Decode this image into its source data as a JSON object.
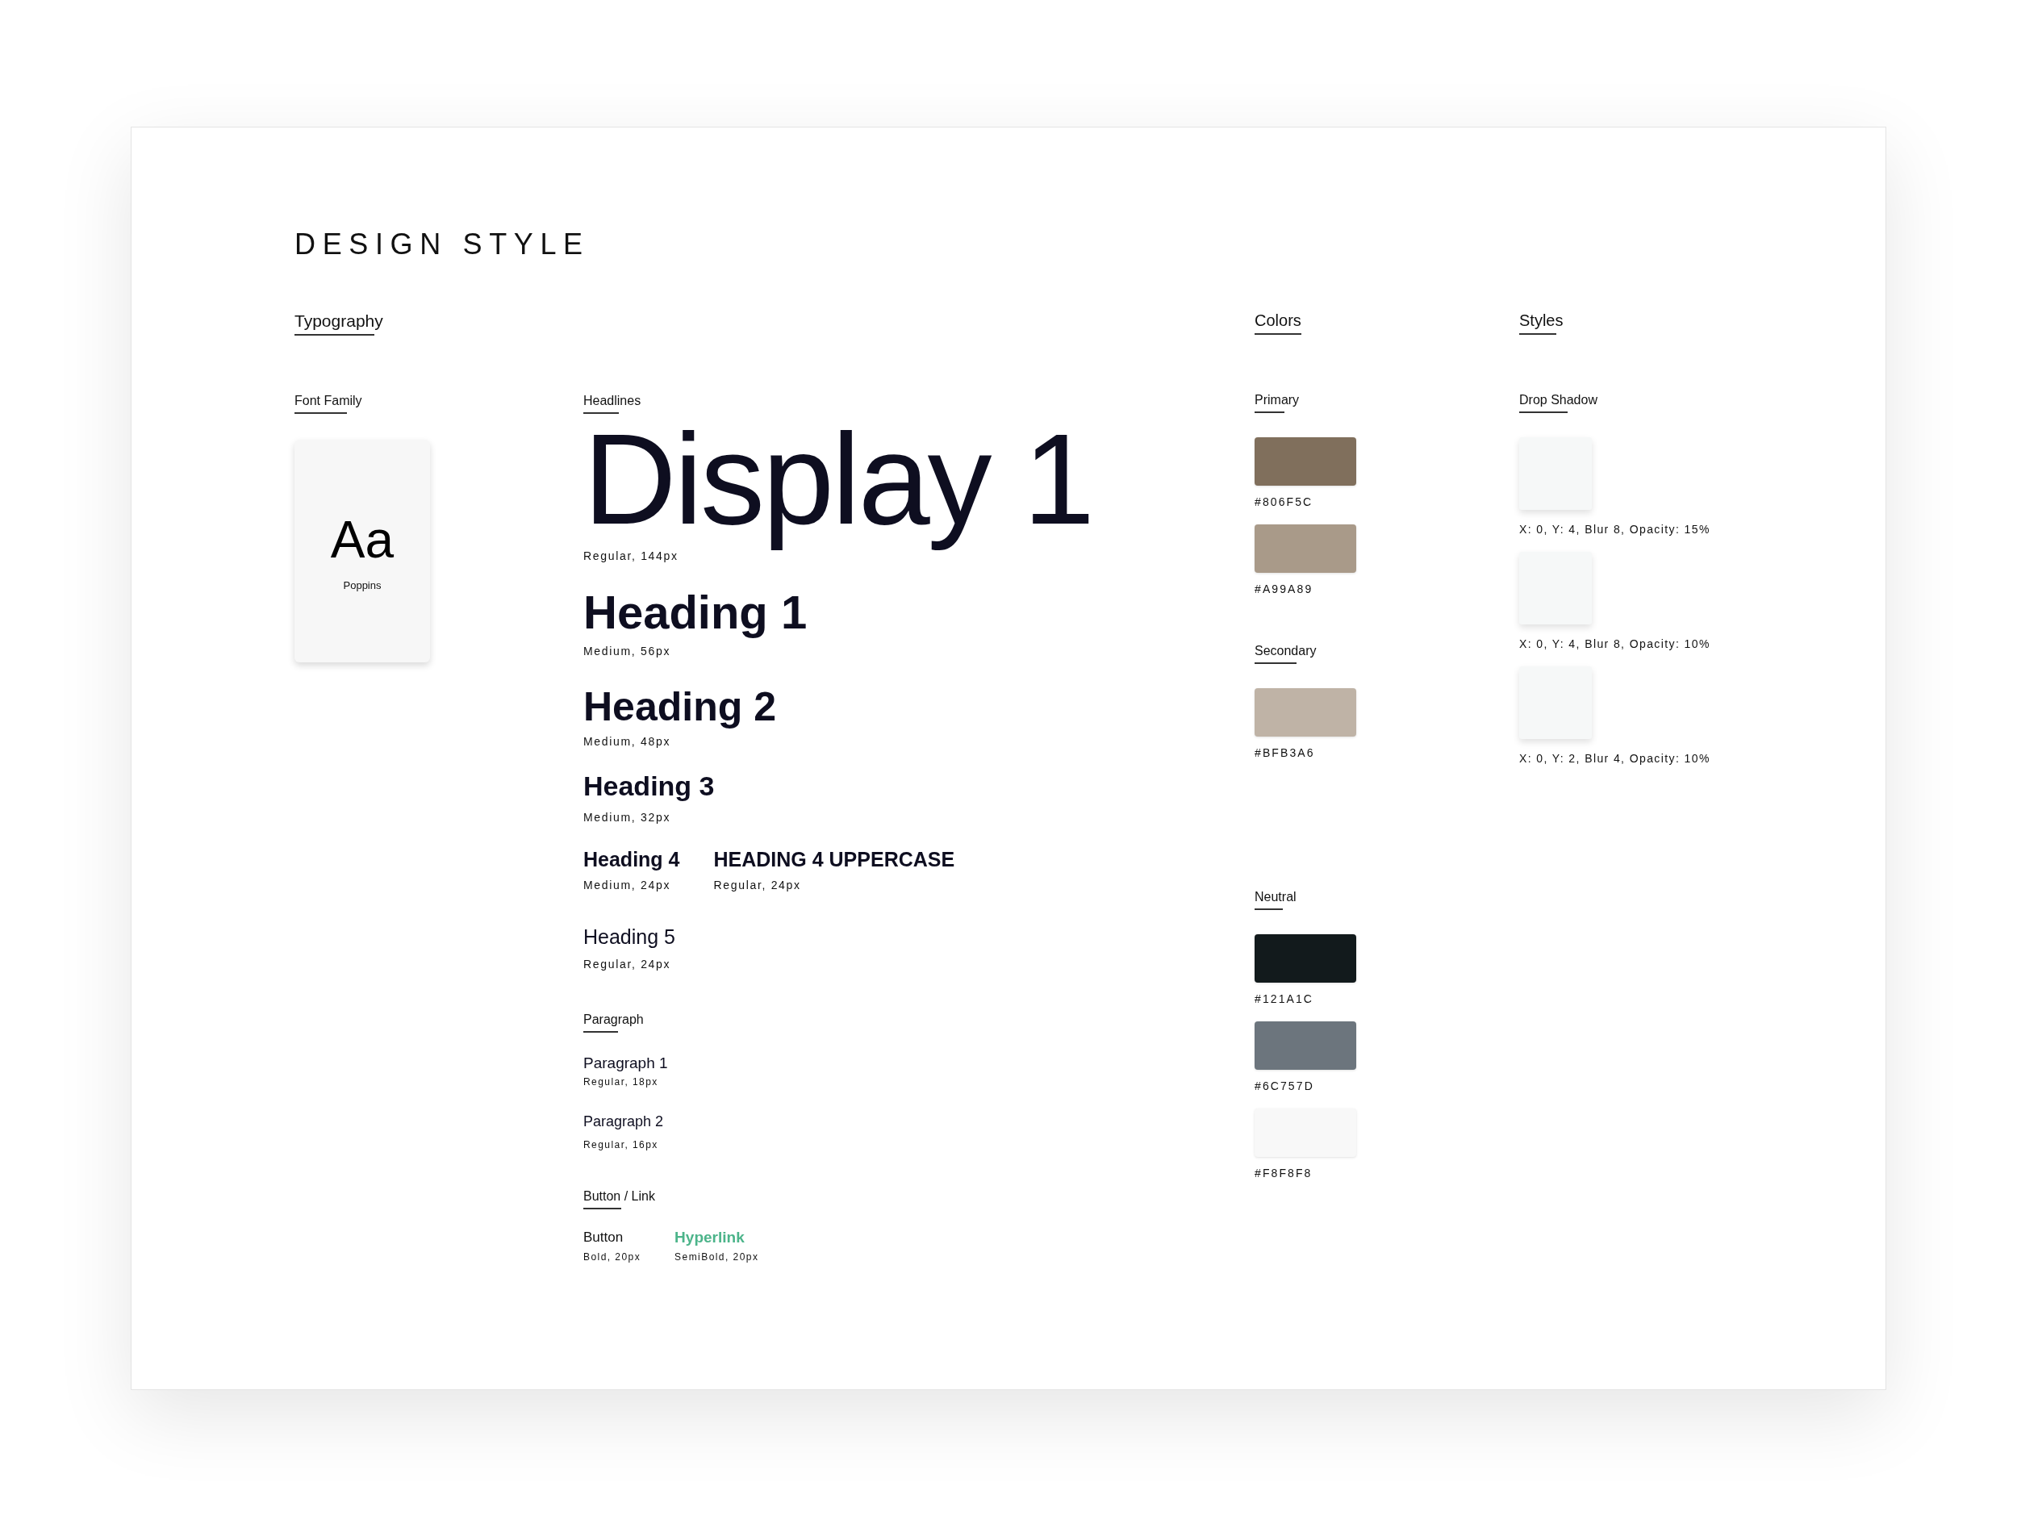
{
  "title": "DESIGN STYLE",
  "typography": {
    "label": "Typography",
    "font_family": {
      "label": "Font Family",
      "sample": "Aa",
      "name": "Poppins"
    },
    "headlines": {
      "label": "Headlines",
      "rows": [
        [
          {
            "kind": "display",
            "text": "Display 1",
            "spec": "Regular, 144px"
          }
        ],
        [
          {
            "kind": "h1",
            "text": "Heading 1",
            "spec": "Medium, 56px"
          }
        ],
        [
          {
            "kind": "h2",
            "text": "Heading 2",
            "spec": "Medium, 48px"
          }
        ],
        [
          {
            "kind": "h3",
            "text": "Heading 3",
            "spec": "Medium, 32px"
          }
        ],
        [
          {
            "kind": "h4",
            "text": "Heading 4",
            "spec": "Medium, 24px"
          },
          {
            "kind": "h4",
            "text": "HEADING 4 UPPERCASE",
            "spec": "Regular, 24px"
          }
        ],
        [
          {
            "kind": "h5",
            "text": "Heading 5",
            "spec": "Regular, 24px"
          }
        ]
      ]
    },
    "paragraph": {
      "label": "Paragraph",
      "items": [
        {
          "kind": "p1",
          "text": "Paragraph 1",
          "spec": "Regular, 18px"
        },
        {
          "kind": "p2",
          "text": "Paragraph 2",
          "spec": "Regular, 16px"
        }
      ]
    },
    "button_link": {
      "label": "Button / Link",
      "items": [
        {
          "kind": "button",
          "text": "Button",
          "spec": "Bold, 20px"
        },
        {
          "kind": "link",
          "text": "Hyperlink",
          "spec": "SemiBold, 20px"
        }
      ]
    }
  },
  "colors": {
    "label": "Colors",
    "groups": [
      {
        "label": "Primary",
        "swatches": [
          {
            "hex": "#806F5C",
            "color": "#806f5c"
          },
          {
            "hex": "#A99A89",
            "color": "#a99a89"
          }
        ]
      },
      {
        "label": "Secondary",
        "swatches": [
          {
            "hex": "#BFB3A6",
            "color": "#bfb3a6"
          }
        ]
      },
      {
        "label": "Neutral",
        "swatches": [
          {
            "hex": "#121A1C",
            "color": "#121a1c"
          },
          {
            "hex": "#6C757D",
            "color": "#6c757d"
          },
          {
            "hex": "#F8F8F8",
            "color": "#f8f8f8"
          }
        ]
      }
    ]
  },
  "styles": {
    "label": "Styles",
    "drop_shadow": {
      "label": "Drop Shadow",
      "items": [
        {
          "spec": "X: 0, Y: 4, Blur 8, Opacity: 15%"
        },
        {
          "spec": "X: 0, Y: 4, Blur 8, Opacity: 10%"
        },
        {
          "spec": "X: 0, Y: 2, Blur 4, Opacity: 10%"
        }
      ]
    }
  }
}
